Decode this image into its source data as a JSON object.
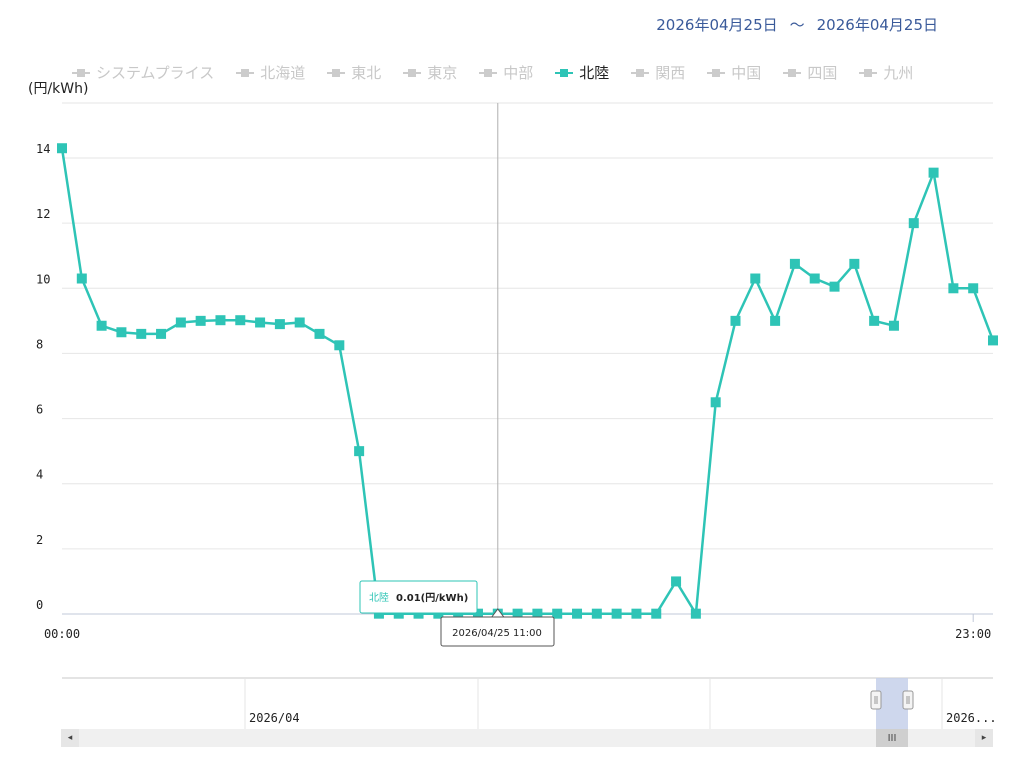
{
  "header": {
    "date_from": "2026年04月25日",
    "date_sep": "〜",
    "date_to": "2026年04月25日"
  },
  "legend": {
    "items": [
      {
        "label": "システムプライス",
        "active": false
      },
      {
        "label": "北海道",
        "active": false
      },
      {
        "label": "東北",
        "active": false
      },
      {
        "label": "東京",
        "active": false
      },
      {
        "label": "中部",
        "active": false
      },
      {
        "label": "北陸",
        "active": true
      },
      {
        "label": "関西",
        "active": false
      },
      {
        "label": "中国",
        "active": false
      },
      {
        "label": "四国",
        "active": false
      },
      {
        "label": "九州",
        "active": false
      }
    ]
  },
  "colors": {
    "series": "#2ec4b6",
    "inactive": "#cccccc",
    "grid": "#e6e6e6",
    "date_text": "#3a5a9a",
    "navigator_mask": "#c6d0ea"
  },
  "chart_data": {
    "type": "line",
    "ylabel": "(円/kWh)",
    "ylim": [
      0,
      14
    ],
    "yticks": [
      0,
      2,
      4,
      6,
      8,
      10,
      12,
      14
    ],
    "x_tick_labels": [
      "00:00",
      "23:00"
    ],
    "series": [
      {
        "name": "北陸",
        "values": [
          14.3,
          10.3,
          8.85,
          8.65,
          8.6,
          8.6,
          8.95,
          9.0,
          9.02,
          9.02,
          8.95,
          8.9,
          8.95,
          8.6,
          8.25,
          5.0,
          0.01,
          0.01,
          0.01,
          0.01,
          0.01,
          0.01,
          0.01,
          0.01,
          0.01,
          0.01,
          0.01,
          0.01,
          0.01,
          0.01,
          0.01,
          1.0,
          0.01,
          6.5,
          9.0,
          10.3,
          9.0,
          10.75,
          10.3,
          10.05,
          10.75,
          9.0,
          8.85,
          12.0,
          13.55,
          10.0,
          10.0,
          8.4
        ]
      }
    ],
    "tooltip": {
      "series": "北陸",
      "value": "0.01(円/kWh)",
      "time": "2026/04/25 11:00"
    }
  },
  "navigator": {
    "month_label": "2026/04",
    "right_label": "2026..."
  },
  "scrollbar": {
    "left_arrow": "◂",
    "right_arrow": "▸",
    "thumb_grip": "III"
  }
}
